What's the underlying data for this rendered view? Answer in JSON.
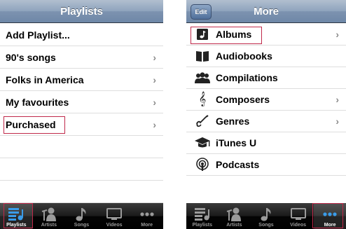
{
  "left": {
    "nav_title": "Playlists",
    "rows": [
      {
        "label": "Add Playlist..."
      },
      {
        "label": "90's songs"
      },
      {
        "label": "Folks in America"
      },
      {
        "label": "My favourites"
      },
      {
        "label": "Purchased"
      }
    ],
    "chevron": "›",
    "tabs": [
      {
        "label": "Playlists",
        "icon": "playlists-icon",
        "selected": true
      },
      {
        "label": "Artists",
        "icon": "artists-icon"
      },
      {
        "label": "Songs",
        "icon": "songs-icon"
      },
      {
        "label": "Videos",
        "icon": "videos-icon"
      },
      {
        "label": "More",
        "icon": "more-icon"
      }
    ]
  },
  "right": {
    "nav_title": "More",
    "edit_label": "Edit",
    "rows": [
      {
        "label": "Albums",
        "icon": "album-icon"
      },
      {
        "label": "Audiobooks",
        "icon": "audiobook-icon"
      },
      {
        "label": "Compilations",
        "icon": "compilations-icon"
      },
      {
        "label": "Composers",
        "icon": "treble-clef-icon"
      },
      {
        "label": "Genres",
        "icon": "guitar-icon"
      },
      {
        "label": "iTunes U",
        "icon": "graduation-cap-icon"
      },
      {
        "label": "Podcasts",
        "icon": "podcast-icon"
      }
    ],
    "chevron": "›",
    "tabs": [
      {
        "label": "Playlists",
        "icon": "playlists-icon"
      },
      {
        "label": "Artists",
        "icon": "artists-icon"
      },
      {
        "label": "Songs",
        "icon": "songs-icon"
      },
      {
        "label": "Videos",
        "icon": "videos-icon"
      },
      {
        "label": "More",
        "icon": "more-icon",
        "selected": true
      }
    ]
  },
  "colors": {
    "nav_gradient_top": "#b1bfcf",
    "nav_gradient_bottom": "#6e87a7",
    "highlight_border": "#c0294a",
    "tab_selected_blue": "#3a9be8"
  }
}
